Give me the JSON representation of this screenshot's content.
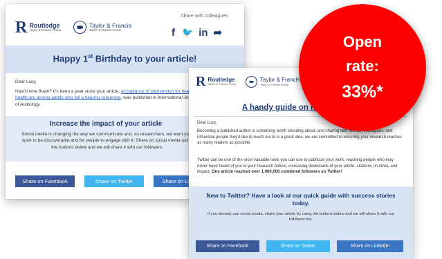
{
  "brand": {
    "routledge": "Routledge",
    "routledge_sub": "Taylor & Francis Group",
    "tf": "Taylor & Francis",
    "tf_sub": "Taylor & Francis Group"
  },
  "email1": {
    "share_label": "Share with colleagues",
    "social": {
      "facebook": "f",
      "twitter": "🐦",
      "linkedin": "in",
      "share": "➦"
    },
    "headline_pre": "Happy 1",
    "headline_sup": "st",
    "headline_post": " Birthday to your article!",
    "greeting": "Dear Lucy,",
    "para1_pre": "Hasn't time flown? It's been a year since your article, ",
    "para1_link": "Acceptance of intervention for hearing health are among adults who fail a hearing screening",
    "para1_mid": ", was published in ",
    "para1_journal": "International Journal of Audiology.",
    "section_title": "Increase the impact of your article",
    "section_body": "Social media is changing the way we communicate and, as researchers, we want your work to be discoverable and for people to engage with it. Share on social media using the buttons below and we will share it with our followers.",
    "buttons": {
      "facebook": "Share on Facebook",
      "twitter": "Share on Twitter",
      "linkedin": "Share on LinkedIn"
    }
  },
  "email2": {
    "headline": "A handy guide on how to share",
    "greeting": "Dear Lucy,",
    "para1": "Becoming a published author is something worth shouting about, and sharing with friends, colleagues, and influential people they'd like to reach out to is a great idea, we are committed to ensuring your research reaches as many readers as possible.",
    "para2_pre": "Twitter can be one of the most valuable tools you can use to publicize your work, reaching people who may never have heard of you or your research before, increasing downloads of your article, citations (in time), and impact. ",
    "para2_bold": "One article reached over 1,000,000 combined followers on Twitter!",
    "section_title": "New to Twitter? Have a look at our quick guide with success stories today.",
    "section_body": "If you already use social media, share your article by using the buttons below and we will share it with our followers too.",
    "buttons": {
      "facebook": "Share on Facebook",
      "twitter": "Share on Twitter",
      "linkedin": "Share on LinkedIn"
    }
  },
  "badge": {
    "line1": "Open",
    "line2": "rate:",
    "line3": "33%*"
  },
  "colors": {
    "badge": "#ff0000",
    "brand_navy": "#1f3b73",
    "facebook": "#3b5998",
    "twitter": "#3fb6f0",
    "linkedin": "#3a75c4",
    "band": "#d6e2f3"
  }
}
